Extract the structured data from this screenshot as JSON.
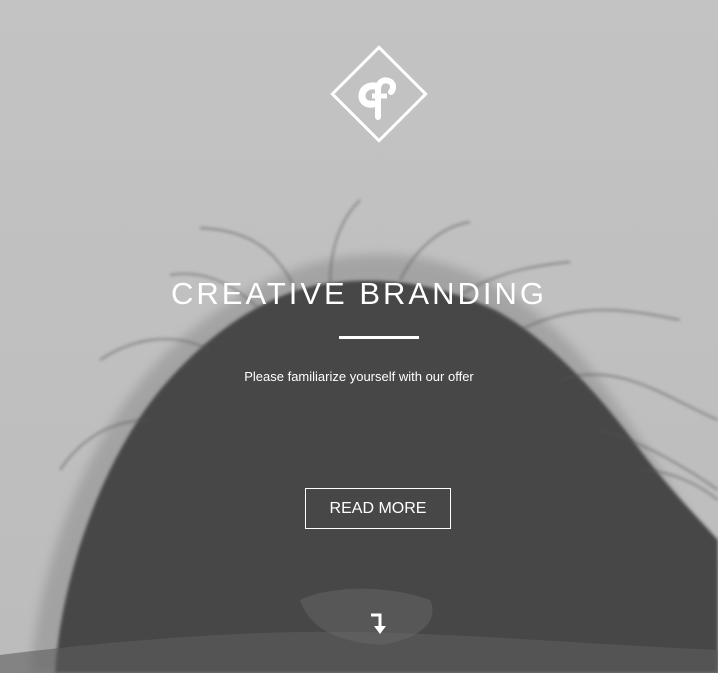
{
  "hero": {
    "background_image": "grayscale-photo-hair-from-behind",
    "title": "CREATIVE BRANDING",
    "subtitle": "Please familiarize yourself with our offer",
    "cta_label": "READ MORE"
  },
  "logo": {
    "name": "diamond-monogram-logo",
    "glyph": "cf"
  },
  "icons": {
    "scroll_down": "arrow-down-turn-icon"
  },
  "colors": {
    "sky": "#c1c1c1",
    "hair": "#454545",
    "text": "#ffffff"
  }
}
